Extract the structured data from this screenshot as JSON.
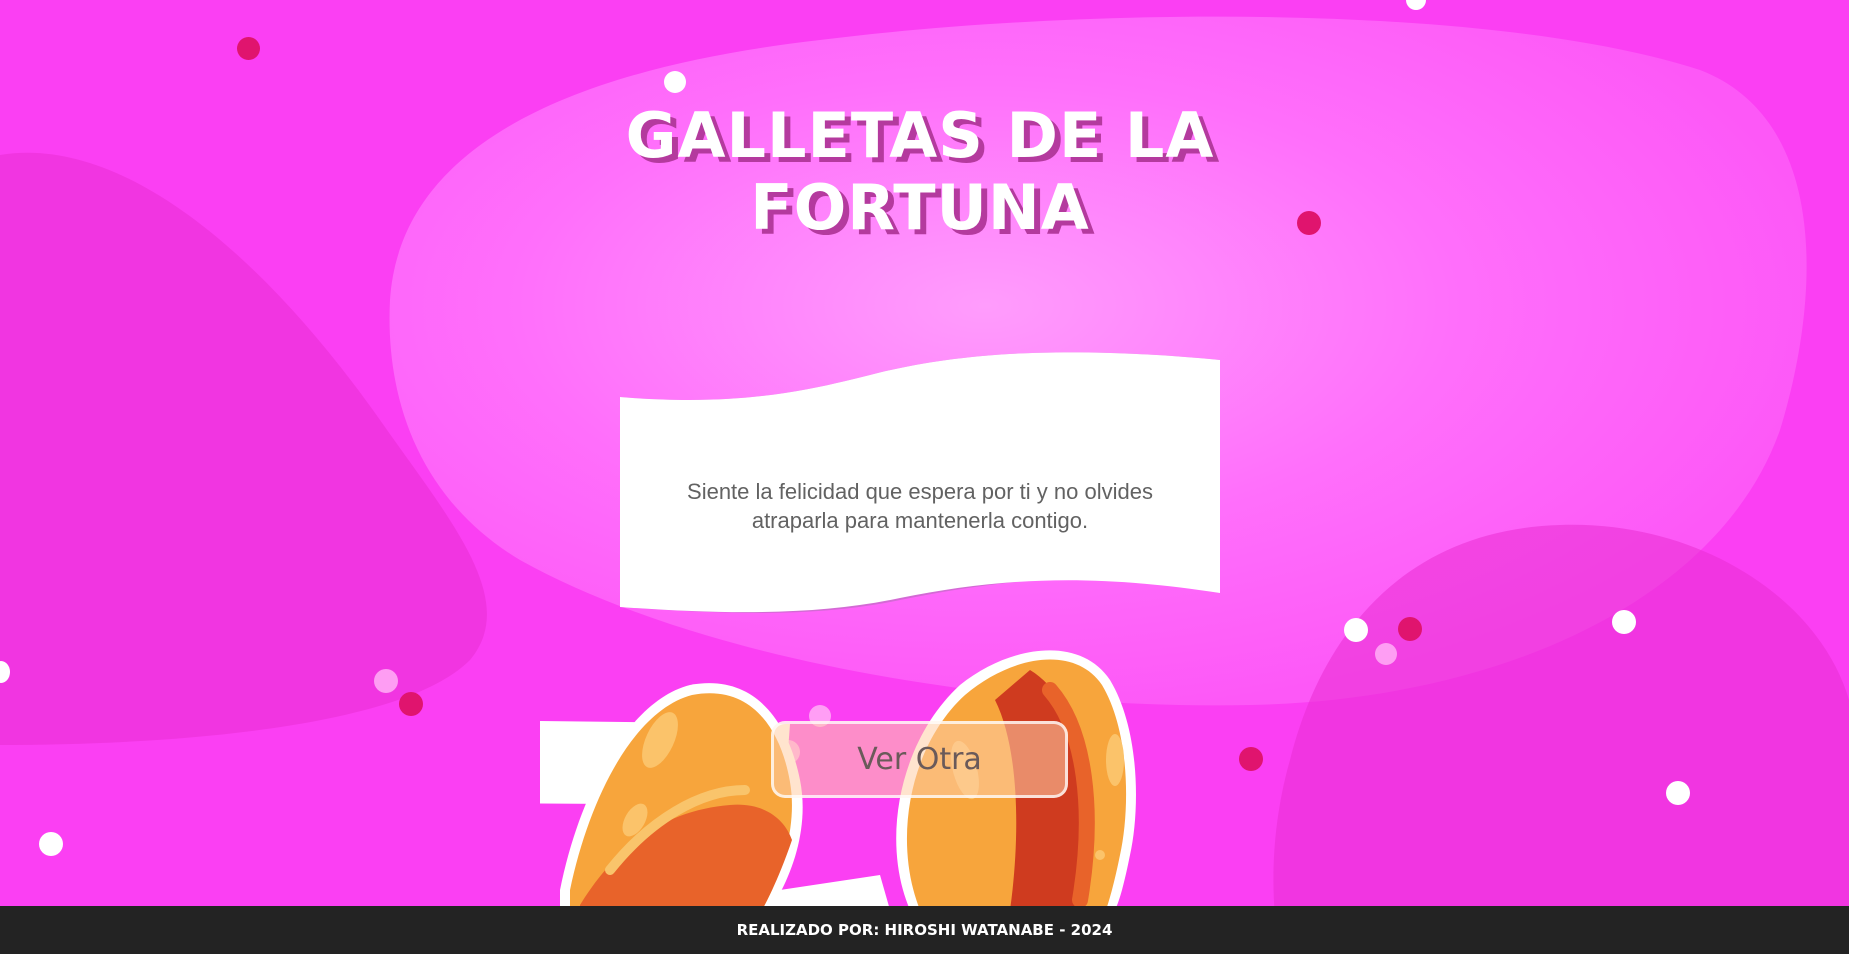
{
  "header": {
    "title_line1": "GALLETAS DE LA",
    "title_line2": "FORTUNA"
  },
  "fortune": {
    "message": "Siente la felicidad que espera por ti y no olvides atraparla para mantenerla contigo."
  },
  "actions": {
    "more_label": "Ver Otra"
  },
  "footer": {
    "credit": "REALIZADO POR: HIROSHI WATANABE - 2024"
  },
  "colors": {
    "background": "#fb3ff3",
    "footer": "#232323",
    "title_shadow": "#b43a9e",
    "note_shadow": "#d36ad4",
    "message_text": "#626262",
    "cookie_orange": "#f5a33a",
    "dot_red": "#e0146e"
  }
}
